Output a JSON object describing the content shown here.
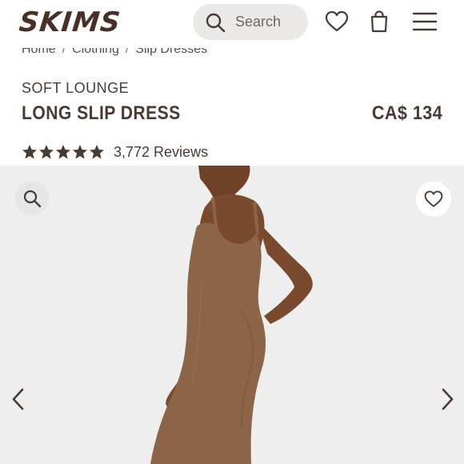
{
  "header": {
    "logo": "SKIMS",
    "search_placeholder": "Search",
    "icons": [
      "search-icon",
      "heart-icon",
      "shopping-bag-icon",
      "menu-icon"
    ]
  },
  "breadcrumb": [
    "Home",
    "Clothing",
    "Slip Dresses"
  ],
  "product": {
    "collection": "SOFT LOUNGE",
    "title": "LONG SLIP DRESS",
    "price": "CA$ 134",
    "rating": 5,
    "reviews": "3,772 Reviews"
  },
  "gallery": {
    "icons": [
      "zoom-icon",
      "heart-icon",
      "chevron-left-icon",
      "chevron-right-icon"
    ]
  },
  "colors": {
    "brand": "#4a2f27",
    "text": "#4a3a34",
    "dress": "#8c6447",
    "skin": "#7a4a2e",
    "gallery_bg": "#eeeeee"
  }
}
